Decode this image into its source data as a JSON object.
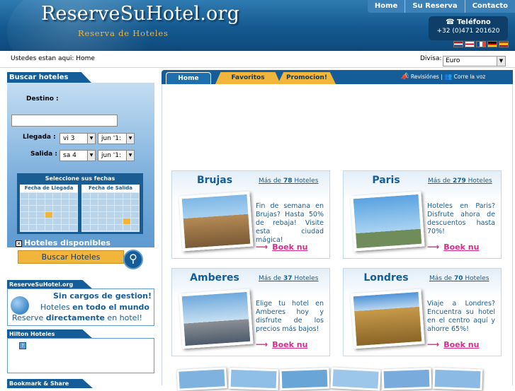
{
  "header": {
    "logo": "ReserveSuHotel.org",
    "tagline": "Reserva de Hoteles",
    "nav": [
      "Home",
      "Su Reserva",
      "Contacto"
    ],
    "phone_label": "Teléfono",
    "phone_number": "+32 (0)471 201620"
  },
  "subbar": {
    "breadcrumb": "Ustedes estan aqui: Home",
    "currency_label": "Divisa:",
    "currency_value": "Euro"
  },
  "search": {
    "title": "Buscar hoteles",
    "destino_label": "Destino :",
    "llegada_label": "Llegada :",
    "llegada_day": "vi 3",
    "llegada_month": "jun '1:",
    "salida_label": "Salida :",
    "salida_day": "sa 4",
    "salida_month": "jun '1:",
    "calendar_title": "Seleccione sus fechas",
    "cal_arrival": "Fecha de Llegada",
    "cal_departure": "Fecha de Salida",
    "checkbox_label": "Hoteles disponibles",
    "button": "Buscar Hoteles"
  },
  "sidebar": {
    "rsh_title": "ReserveSuHotel.org",
    "rsh_line1": "Sin cargos de gestion!",
    "rsh_line2_a": "Hoteles ",
    "rsh_line2_b": "en todo el mundo",
    "rsh_line3_a": "Reserve ",
    "rsh_line3_b": "directamente",
    "rsh_line3_c": " en hotel!",
    "hilton_title": "Hilton Hoteles",
    "bookmark_title": "Bookmark & Share"
  },
  "tabs": {
    "home": "Home",
    "favoritos": "Favoritos",
    "promocion": "Promocion!",
    "revisiones": "Revisiónes",
    "corre": "Corre la voz"
  },
  "cards": [
    {
      "city": "Brujas",
      "more_a": "Más de ",
      "more_n": "78",
      "more_b": " Hoteles",
      "desc": "Fin de semana en Brujas? Hasta 50% de rebaja! Visite esta ciudad mágica!",
      "cta": "Boek nu"
    },
    {
      "city": "Paris",
      "more_a": "Más de ",
      "more_n": "279",
      "more_b": " Hoteles",
      "desc": "Hoteles en Paris? Disfrute ahora de descuentos hasta 70%!",
      "cta": "Boek nu"
    },
    {
      "city": "Amberes",
      "more_a": "Más de ",
      "more_n": "37",
      "more_b": " Hoteles",
      "desc": "Elige tu hotel en Amberes hoy y disfrute de los precios más bajos!",
      "cta": "Boek nu"
    },
    {
      "city": "Londres",
      "more_a": "Más de ",
      "more_n": "70",
      "more_b": " Hoteles",
      "desc": "Viaje a Londres? Encuentra su hotel en el centro aquí y ahorre 65%!",
      "cta": "Boek nu"
    }
  ],
  "colors": {
    "brand": "#155d98",
    "accent": "#f2b53c",
    "cta": "#d42b8c"
  }
}
